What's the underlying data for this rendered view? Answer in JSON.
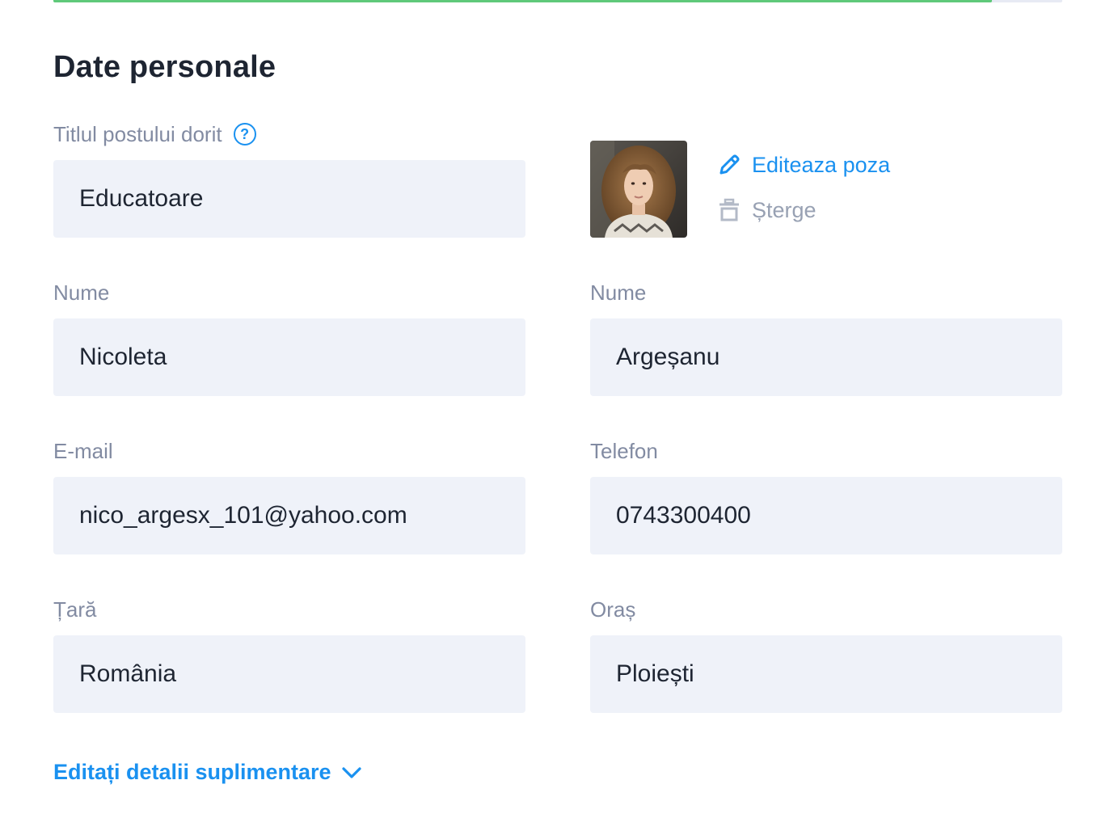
{
  "progress": {
    "fraction": 0.93,
    "color": "#5fc97a"
  },
  "section": {
    "title": "Date personale"
  },
  "job_title": {
    "label": "Titlul postului dorit",
    "help_icon": "question-circle-icon",
    "value": "Educatoare"
  },
  "photo": {
    "edit_label": "Editeaza poza",
    "edit_icon": "pencil-icon",
    "delete_label": "Șterge",
    "delete_icon": "trash-icon"
  },
  "first_name": {
    "label": "Nume",
    "value": "Nicoleta"
  },
  "last_name": {
    "label": "Nume",
    "value": "Argeșanu"
  },
  "email": {
    "label": "E-mail",
    "value": "nico_argesx_101@yahoo.com"
  },
  "phone": {
    "label": "Telefon",
    "value": "0743300400"
  },
  "country": {
    "label": "Țară",
    "value": "România"
  },
  "city": {
    "label": "Oraș",
    "value": "Ploiești"
  },
  "more_details": {
    "label": "Editați detalii suplimentare",
    "icon": "chevron-down-icon"
  },
  "colors": {
    "accent": "#1a91f0",
    "input_bg": "#eff2f9",
    "label": "#828ba2"
  }
}
